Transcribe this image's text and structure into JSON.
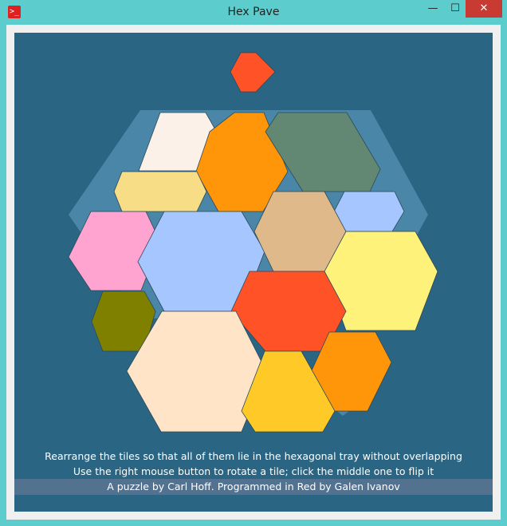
{
  "window": {
    "title": "Hex Pave",
    "icon": "red-terminal-icon",
    "controls": {
      "minimize": "—",
      "maximize": "☐",
      "close": "✕"
    }
  },
  "messages": {
    "line1": "Rearrange the tiles so that all of them lie in the hexagonal tray without overlapping",
    "line2": "Use the right mouse button to rotate a tile; click the middle one to flip it",
    "credit": "A puzzle by Carl Hoff. Programmed in Red by Galen Ivanov"
  },
  "colors": {
    "board_bg": "#2a6583",
    "tray": "#4a86a8",
    "credit_bar": "#53728f",
    "text": "#ffffff"
  },
  "tiles": [
    {
      "id": "red-small",
      "color": "#ff5227"
    },
    {
      "id": "linen",
      "color": "#fcf1e8"
    },
    {
      "id": "orange-top",
      "color": "#ff9508"
    },
    {
      "id": "sage-green",
      "color": "#628873"
    },
    {
      "id": "khaki",
      "color": "#f6dd86"
    },
    {
      "id": "light-blue-small",
      "color": "#a6c6ff"
    },
    {
      "id": "pink",
      "color": "#ffa3d1"
    },
    {
      "id": "light-blue-large",
      "color": "#a6c6ff"
    },
    {
      "id": "tan",
      "color": "#e0b98a"
    },
    {
      "id": "light-yellow",
      "color": "#fff27a"
    },
    {
      "id": "olive",
      "color": "#808000"
    },
    {
      "id": "red-orange",
      "color": "#ff5227"
    },
    {
      "id": "bisque",
      "color": "#ffe4c7"
    },
    {
      "id": "dark-orange",
      "color": "#ff9508"
    },
    {
      "id": "gold",
      "color": "#ffca28"
    }
  ]
}
